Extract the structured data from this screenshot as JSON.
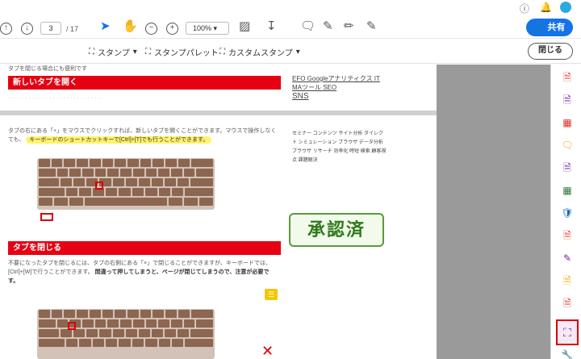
{
  "top": {
    "help_icon": "?",
    "bell_icon": "bell"
  },
  "toolbar": {
    "page_current": "3",
    "page_total": "/ 17",
    "zoom": "100%",
    "share_label": "共有"
  },
  "stampbar": {
    "stamp_label": "スタンプ",
    "palette_label": "スタンプパレット",
    "custom_label": "カスタムスタンプ",
    "close_label": "閉じる"
  },
  "doc": {
    "heading1": "新しいタブを開く",
    "para1": "タブの右にある「+」をマウスでクリックすれば、新しいタブを開くことができます。マウスで操作しなくても、",
    "highlight1": "キーボードのショートカットキーで[Ctrl]+[T]でも行うことができます。",
    "heading2": "タブを閉じる",
    "para2": "不要になったタブを閉じるには、タブの右側にある「×」で閉じることができますが、キーボードでは、[Ctrl]+[W]で行うことができます。",
    "para2_bold": "間違って押してしまうと、ページが閉じてしまうので、注意が必要です。",
    "top_fragment": "タブを閉じる場合にも便利です"
  },
  "tags": {
    "line1": "EFO Googleアナリティクス IT MAツール SEO",
    "line2": "SNS",
    "block": "セミナー コンテンツ サイト分析 ダイレクト シミュレーション ブラウザ データ分析 ブラウザ リサーチ 効率化 時短 検索 顧客視点 課題解決"
  },
  "stamp": {
    "text": "承認済"
  },
  "sidebar": {
    "items": [
      "create-pdf-icon",
      "combine-icon",
      "organize-icon",
      "comment-icon",
      "export-icon",
      "compress-icon",
      "protect-icon",
      "fill-sign-icon",
      "edit-icon",
      "request-icon",
      "stamp-icon",
      "tools-icon"
    ]
  }
}
